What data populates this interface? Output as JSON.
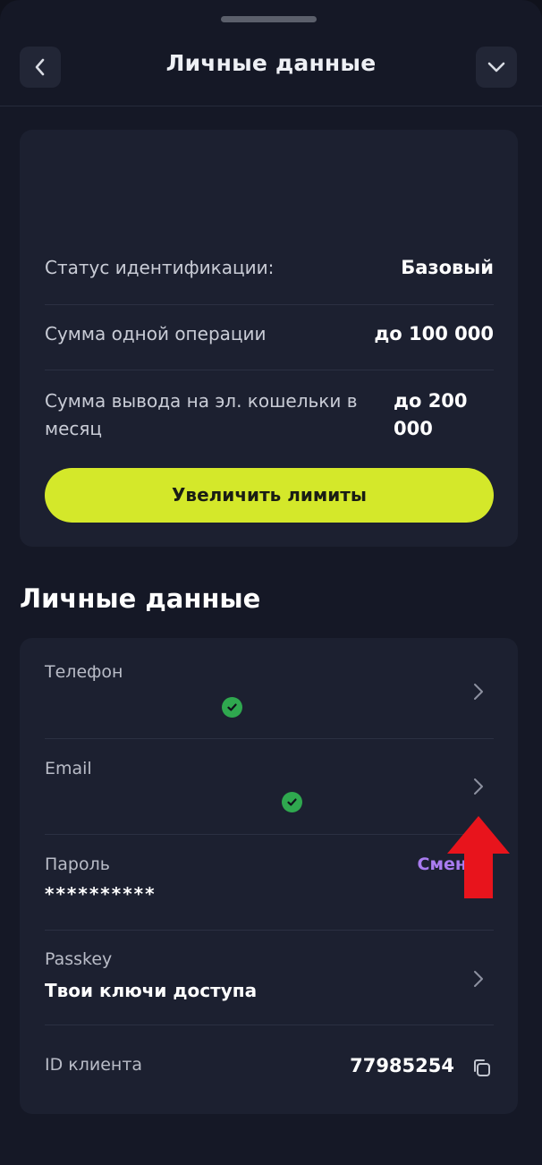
{
  "header": {
    "title": "Личные данные",
    "back_icon": "chevron-left-icon",
    "collapse_icon": "chevron-down-icon"
  },
  "limits": {
    "rows": [
      {
        "label": "Статус идентификации:",
        "value": "Базовый"
      },
      {
        "label": "Сумма одной операции",
        "value": "до 100 000"
      },
      {
        "label": "Сумма вывода на эл. кошельки в месяц",
        "value": "до 200 000"
      }
    ],
    "button_label": "Увеличить лимиты"
  },
  "personal": {
    "section_title": "Личные данные",
    "phone": {
      "label": "Телефон",
      "verified": true
    },
    "email": {
      "label": "Email",
      "verified": true
    },
    "password": {
      "label": "Пароль",
      "value": "**********",
      "action": "Смен"
    },
    "passkey": {
      "label": "Passkey",
      "value": "Твои ключи доступа"
    },
    "client_id": {
      "label": "ID клиента",
      "value": "77985254"
    }
  },
  "colors": {
    "accent_button": "#d4e82a",
    "link": "#a97cf0",
    "verified": "#2fa84f",
    "annotation_arrow": "#e8141c"
  }
}
